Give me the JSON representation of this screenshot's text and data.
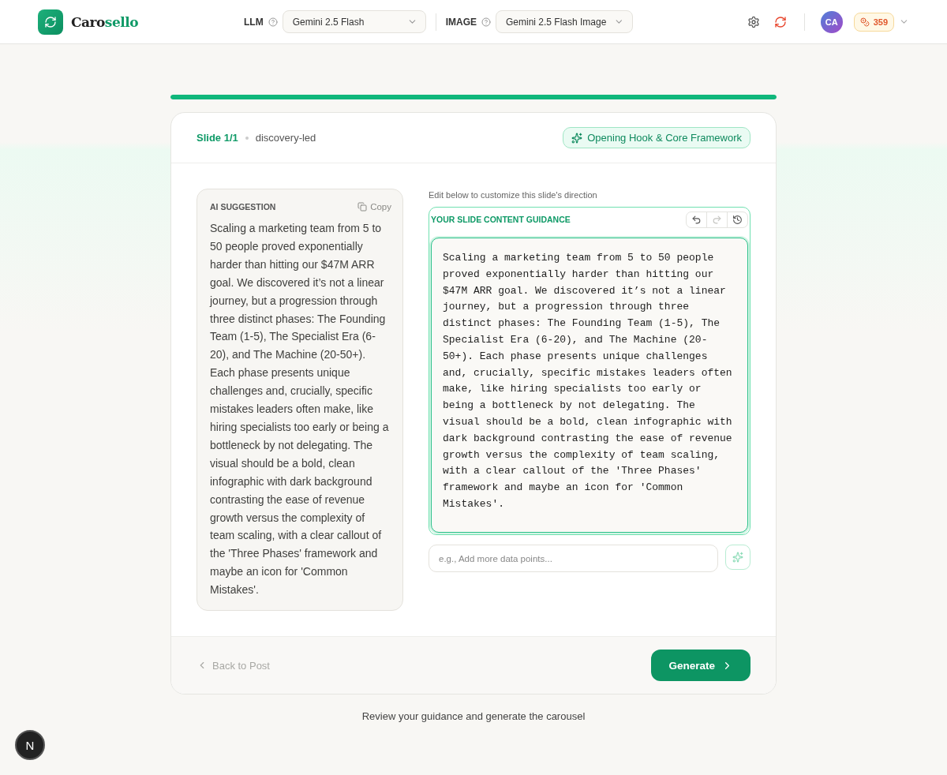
{
  "header": {
    "brand": {
      "dark": "Caro",
      "accent": "sello"
    },
    "models": [
      {
        "label": "LLM",
        "value": "Gemini 2.5 Flash"
      },
      {
        "label": "IMAGE",
        "value": "Gemini 2.5 Flash Image"
      }
    ],
    "avatar": "CA",
    "credits": "359"
  },
  "progress": {
    "level": 1
  },
  "slide": {
    "counter": "Slide 1/1",
    "style": "discovery-led",
    "badge": "Opening Hook & Core Framework"
  },
  "suggestion": {
    "title": "AI SUGGESTION",
    "copy": "Copy",
    "text": "Scaling a marketing team from 5 to 50 people proved exponentially harder than hitting our $47M ARR goal. We discovered it’s not a linear journey, but a progression through three distinct phases: The Founding Team (1-5), The Specialist Era (6-20), and The Machine (20-50+). Each phase presents unique challenges and, crucially, specific mistakes leaders often make, like hiring specialists too early or being a bottleneck by not delegating. The visual should be a bold, clean infographic with dark background contrasting the ease of revenue growth versus the complexity of team scaling, with a clear callout of the 'Three Phases' framework and maybe an icon for 'Common Mistakes'."
  },
  "editor": {
    "hint": "Edit below to customize this slide's direction",
    "title": "YOUR SLIDE CONTENT GUIDANCE",
    "tools": [
      {
        "kind": "undo",
        "disabled": false
      },
      {
        "kind": "redo",
        "disabled": true
      },
      {
        "kind": "history",
        "disabled": false
      }
    ],
    "value": "Scaling a marketing team from 5 to 50 people proved exponentially harder than hitting our $47M ARR goal. We discovered it’s not a linear journey, but a progression through three distinct phases: The Founding Team (1-5), The Specialist Era (6-20), and The Machine (20-50+). Each phase presents unique challenges and, crucially, specific mistakes leaders often make, like hiring specialists too early or being a bottleneck by not delegating. The visual should be a bold, clean infographic with dark background contrasting the ease of revenue growth versus the complexity of team scaling, with a clear callout of the 'Three Phases' framework and maybe an icon for 'Common Mistakes'.",
    "refine_placeholder": "e.g., Add more data points..."
  },
  "footer": {
    "back": {
      "label": "Back to Post",
      "disabled": true
    },
    "generate": "Generate"
  },
  "caption": "Review your guidance and generate the carousel",
  "fab": "N"
}
